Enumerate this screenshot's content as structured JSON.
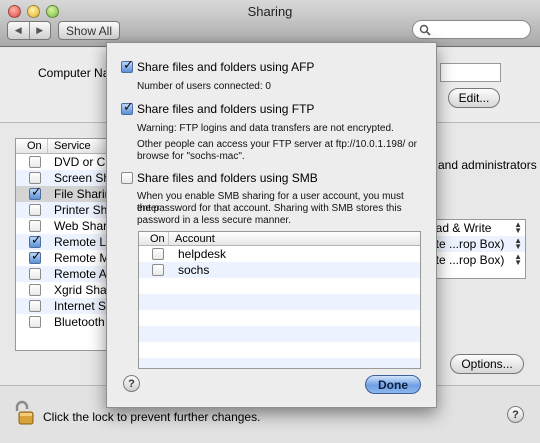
{
  "window": {
    "title": "Sharing",
    "show_all_label": "Show All",
    "search_placeholder": ""
  },
  "top": {
    "computer_name_label": "Computer Na",
    "edit_label": "Edit..."
  },
  "services": {
    "col_on": "On",
    "col_service": "Service",
    "items": [
      {
        "label": "DVD or CD",
        "checked": false
      },
      {
        "label": "Screen Shar",
        "checked": false
      },
      {
        "label": "File Sharing",
        "checked": true
      },
      {
        "label": "Printer Sha",
        "checked": false
      },
      {
        "label": "Web Sharin",
        "checked": false
      },
      {
        "label": "Remote Lo",
        "checked": true
      },
      {
        "label": "Remote Ma",
        "checked": true
      },
      {
        "label": "Remote Ap",
        "checked": false
      },
      {
        "label": "Xgrid Sharin",
        "checked": false
      },
      {
        "label": "Internet Sha",
        "checked": false
      },
      {
        "label": "Bluetooth S",
        "checked": false
      }
    ]
  },
  "right_panel": {
    "admin_text": "and administrators",
    "permissions": [
      {
        "label": "ead & Write"
      },
      {
        "label": "rite ...rop Box)"
      },
      {
        "label": "rite ...rop Box)"
      }
    ],
    "options_label": "Options..."
  },
  "footer": {
    "lock_text": "Click the lock to prevent further changes."
  },
  "sheet": {
    "afp": {
      "label": "Share files and folders using AFP",
      "checked": true,
      "note": "Number of users connected: 0"
    },
    "ftp": {
      "label": "Share files and folders using FTP",
      "checked": true,
      "warning": "Warning: FTP logins and data transfers are not encrypted.",
      "access_line1": "Other people can access your FTP server at ftp://10.0.1.198/ or",
      "access_line2": "browse for \"sochs-mac\"."
    },
    "smb": {
      "label": "Share files and folders using SMB",
      "checked": false,
      "desc_line1": "When you enable SMB sharing for a user account, you must enter",
      "desc_line2": "the password for that account. Sharing with SMB stores this",
      "desc_line3": "password in a less secure manner."
    },
    "accounts": {
      "col_on": "On",
      "col_account": "Account",
      "rows": [
        {
          "name": "helpdesk",
          "checked": false
        },
        {
          "name": "sochs",
          "checked": false
        }
      ]
    },
    "done_label": "Done",
    "help_glyph": "?"
  },
  "help_glyph": "?"
}
